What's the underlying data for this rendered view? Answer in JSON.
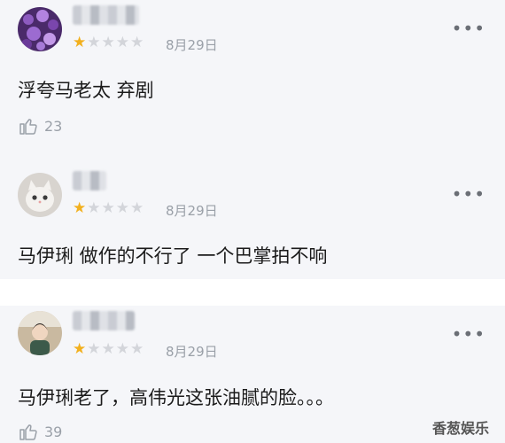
{
  "comments": [
    {
      "rating": 1,
      "date": "8月29日",
      "text": "浮夸马老太 弃剧",
      "likes": "23",
      "avatar": "purple-flowers"
    },
    {
      "rating": 1,
      "date": "8月29日",
      "text": "马伊琍 做作的不行了 一个巴掌拍不响",
      "avatar": "white-cat"
    },
    {
      "rating": 1,
      "date": "8月29日",
      "text": "马伊琍老了，高伟光这张油腻的脸。。。",
      "likes": "39",
      "avatar": "person-photo"
    }
  ],
  "more_label": "•••",
  "stars_total": 5,
  "watermark": "香葱娱乐",
  "colors": {
    "star_on": "#f2b01e",
    "star_off": "#d3d5da",
    "bg": "#f5f6f9"
  }
}
